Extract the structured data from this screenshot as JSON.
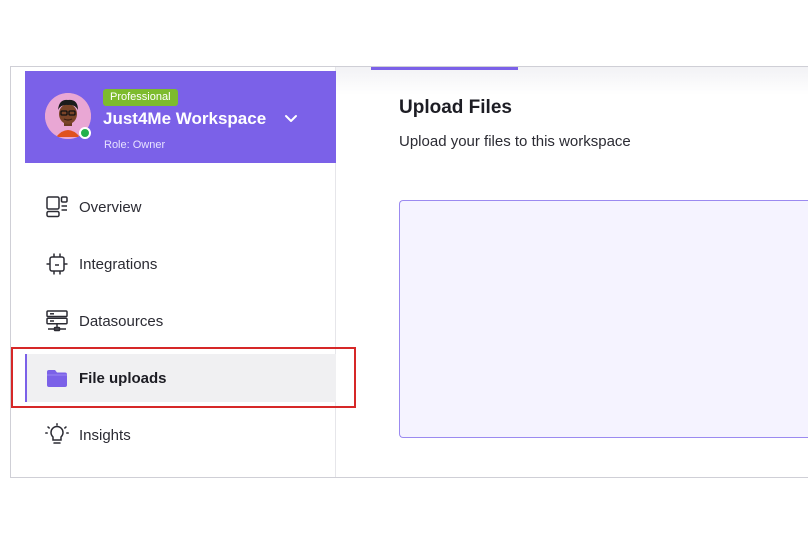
{
  "workspace": {
    "plan_badge": "Professional",
    "name": "Just4Me Workspace",
    "role": "Role: Owner"
  },
  "sidebar": {
    "items": [
      {
        "label": "Overview",
        "icon": "overview-icon"
      },
      {
        "label": "Integrations",
        "icon": "integrations-icon"
      },
      {
        "label": "Datasources",
        "icon": "datasources-icon"
      },
      {
        "label": "File uploads",
        "icon": "folder-icon",
        "active": true
      },
      {
        "label": "Insights",
        "icon": "lightbulb-icon"
      }
    ]
  },
  "main": {
    "title": "Upload Files",
    "subtitle": "Upload your files to this workspace"
  },
  "colors": {
    "accent": "#7b61e8",
    "plan_badge": "#7dbb2d",
    "online": "#23b24b",
    "highlight": "#d62828",
    "dropzone_bg": "#f5f3ff"
  }
}
